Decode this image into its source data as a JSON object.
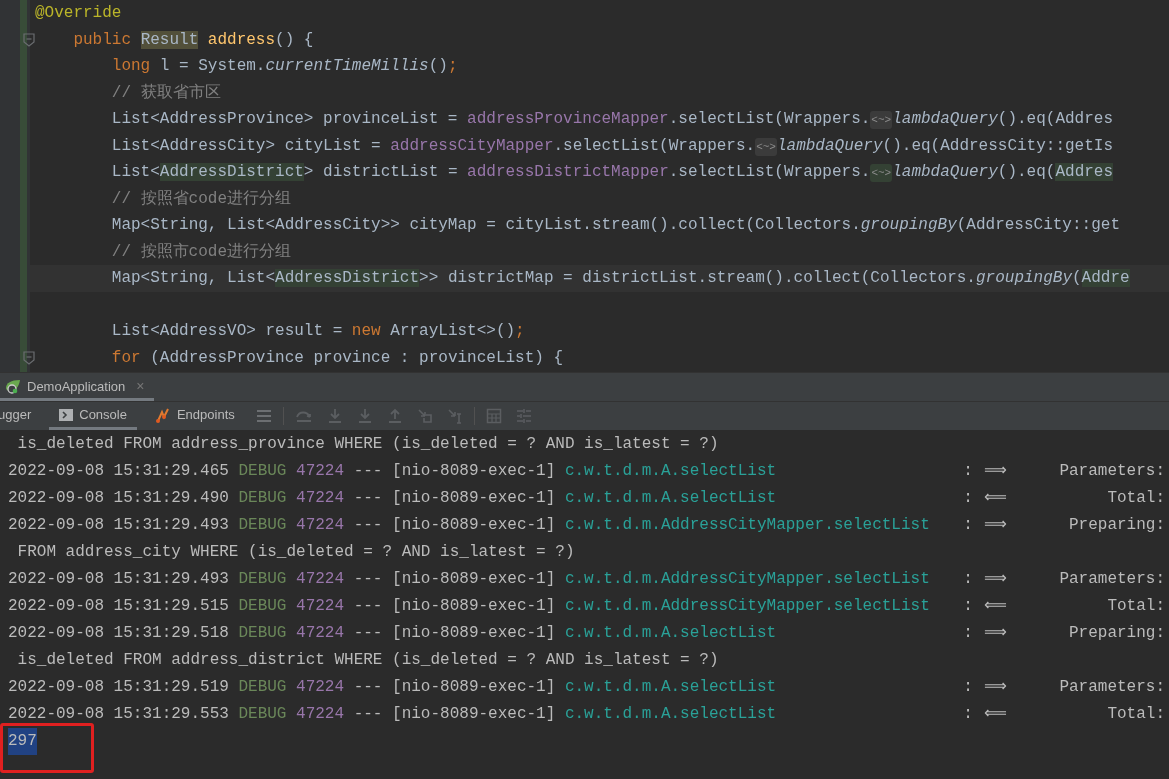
{
  "editor": {
    "lines": [
      {
        "kind": "code",
        "fold": false,
        "current": false,
        "segments": [
          {
            "text": "@Override",
            "kind": "annotation"
          }
        ]
      },
      {
        "kind": "code",
        "fold": true,
        "current": false,
        "segments": [
          {
            "text": "    public ",
            "kind": "keyword"
          },
          {
            "text": "Result",
            "kind": "usage"
          },
          {
            "text": " address",
            "kind": "method"
          },
          {
            "text": "() {",
            "kind": "plain"
          }
        ]
      },
      {
        "kind": "code",
        "fold": false,
        "current": false,
        "segments": [
          {
            "text": "        long",
            "kind": "keyword"
          },
          {
            "text": " l = System.",
            "kind": "plain"
          },
          {
            "text": "currentTimeMillis",
            "kind": "static"
          },
          {
            "text": "()",
            "kind": "plain"
          },
          {
            "text": ";",
            "kind": "keyword"
          }
        ]
      },
      {
        "kind": "code",
        "fold": false,
        "current": false,
        "segments": [
          {
            "text": "        // 获取省市区",
            "kind": "comment"
          }
        ]
      },
      {
        "kind": "code",
        "fold": false,
        "current": false,
        "segments": [
          {
            "text": "        List<AddressProvince> provinceList = ",
            "kind": "plain"
          },
          {
            "text": "addressProvinceMapper",
            "kind": "field"
          },
          {
            "text": ".selectList(Wrappers.",
            "kind": "plain"
          },
          {
            "text": "<~>",
            "kind": "hint"
          },
          {
            "text": "lambdaQuery",
            "kind": "static"
          },
          {
            "text": "().eq(Addres",
            "kind": "plain"
          }
        ]
      },
      {
        "kind": "code",
        "fold": false,
        "current": false,
        "segments": [
          {
            "text": "        List<AddressCity> cityList = ",
            "kind": "plain"
          },
          {
            "text": "addressCityMapper",
            "kind": "field"
          },
          {
            "text": ".selectList(Wrappers.",
            "kind": "plain"
          },
          {
            "text": "<~>",
            "kind": "hint"
          },
          {
            "text": "lambdaQuery",
            "kind": "static"
          },
          {
            "text": "().eq(AddressCity::getIs",
            "kind": "plain"
          }
        ]
      },
      {
        "kind": "code",
        "fold": false,
        "current": false,
        "segments": [
          {
            "text": "        List<",
            "kind": "plain"
          },
          {
            "text": "AddressDistrict",
            "kind": "write"
          },
          {
            "text": "> districtList = ",
            "kind": "plain"
          },
          {
            "text": "addressDistrictMapper",
            "kind": "field"
          },
          {
            "text": ".selectList(Wrappers.",
            "kind": "plain"
          },
          {
            "text": "<~>",
            "kind": "hint-write"
          },
          {
            "text": "lambdaQuery",
            "kind": "static"
          },
          {
            "text": "().eq(",
            "kind": "plain"
          },
          {
            "text": "Addres",
            "kind": "write"
          }
        ]
      },
      {
        "kind": "code",
        "fold": false,
        "current": false,
        "segments": [
          {
            "text": "        // 按照省code进行分组",
            "kind": "comment"
          }
        ]
      },
      {
        "kind": "code",
        "fold": false,
        "current": false,
        "segments": [
          {
            "text": "        Map<String, List<AddressCity>> cityMap = cityList.stream().collect(Collectors.",
            "kind": "plain"
          },
          {
            "text": "groupingBy",
            "kind": "static"
          },
          {
            "text": "(AddressCity::get",
            "kind": "plain"
          }
        ]
      },
      {
        "kind": "code",
        "fold": false,
        "current": false,
        "segments": [
          {
            "text": "        // 按照市code进行分组",
            "kind": "comment"
          }
        ]
      },
      {
        "kind": "code",
        "fold": false,
        "current": true,
        "segments": [
          {
            "text": "        Map<String, List<",
            "kind": "plain"
          },
          {
            "text": "AddressDistrict",
            "kind": "write"
          },
          {
            "text": ">> districtMap = districtList.stream().collect(Collectors.",
            "kind": "plain"
          },
          {
            "text": "groupingBy",
            "kind": "static"
          },
          {
            "text": "(",
            "kind": "plain"
          },
          {
            "text": "Addre",
            "kind": "write"
          }
        ]
      },
      {
        "kind": "blank",
        "fold": false,
        "current": false
      },
      {
        "kind": "code",
        "fold": false,
        "current": false,
        "segments": [
          {
            "text": "        List<AddressVO> result = ",
            "kind": "plain"
          },
          {
            "text": "new",
            "kind": "keyword"
          },
          {
            "text": " ArrayList<>()",
            "kind": "plain"
          },
          {
            "text": ";",
            "kind": "keyword"
          }
        ]
      },
      {
        "kind": "code",
        "fold": true,
        "current": false,
        "segments": [
          {
            "text": "        for",
            "kind": "keyword"
          },
          {
            "text": " (AddressProvince province : provinceList) {",
            "kind": "plain"
          }
        ]
      }
    ]
  },
  "run_tab": {
    "label": "DemoApplication",
    "close": "×"
  },
  "tool_tabs": [
    {
      "label": "ugger",
      "selected": false,
      "kind": "plain"
    },
    {
      "label": "Console",
      "selected": true,
      "kind": "console"
    },
    {
      "label": "Endpoints",
      "selected": false,
      "kind": "endpoints"
    }
  ],
  "console": [
    {
      "kind": "sql",
      "text": " is_deleted FROM address_province WHERE (is_deleted = ? AND is_latest = ?)"
    },
    {
      "kind": "log",
      "time": "2022-09-08 15:31:29.465",
      "level": "DEBUG",
      "pid": "47224",
      "sep": "---",
      "thread": "[nio-8089-exec-1]",
      "logger": "c.w.t.d.m.A.selectList",
      "colon": ":",
      "arrow": "⟹",
      "message": "Parameters:"
    },
    {
      "kind": "log",
      "time": "2022-09-08 15:31:29.490",
      "level": "DEBUG",
      "pid": "47224",
      "sep": "---",
      "thread": "[nio-8089-exec-1]",
      "logger": "c.w.t.d.m.A.selectList",
      "colon": ":",
      "arrow": "⟸",
      "message": "Total:"
    },
    {
      "kind": "log",
      "time": "2022-09-08 15:31:29.493",
      "level": "DEBUG",
      "pid": "47224",
      "sep": "---",
      "thread": "[nio-8089-exec-1]",
      "logger": "c.w.t.d.m.AddressCityMapper.selectList",
      "colon": ":",
      "arrow": "⟹",
      "message": "Preparing:"
    },
    {
      "kind": "sql",
      "text": " FROM address_city WHERE (is_deleted = ? AND is_latest = ?)"
    },
    {
      "kind": "log",
      "time": "2022-09-08 15:31:29.493",
      "level": "DEBUG",
      "pid": "47224",
      "sep": "---",
      "thread": "[nio-8089-exec-1]",
      "logger": "c.w.t.d.m.AddressCityMapper.selectList",
      "colon": ":",
      "arrow": "⟹",
      "message": "Parameters:"
    },
    {
      "kind": "log",
      "time": "2022-09-08 15:31:29.515",
      "level": "DEBUG",
      "pid": "47224",
      "sep": "---",
      "thread": "[nio-8089-exec-1]",
      "logger": "c.w.t.d.m.AddressCityMapper.selectList",
      "colon": ":",
      "arrow": "⟸",
      "message": "Total:"
    },
    {
      "kind": "log",
      "time": "2022-09-08 15:31:29.518",
      "level": "DEBUG",
      "pid": "47224",
      "sep": "---",
      "thread": "[nio-8089-exec-1]",
      "logger": "c.w.t.d.m.A.selectList",
      "colon": ":",
      "arrow": "⟹",
      "message": "Preparing:"
    },
    {
      "kind": "sql",
      "text": " is_deleted FROM address_district WHERE (is_deleted = ? AND is_latest = ?)"
    },
    {
      "kind": "log",
      "time": "2022-09-08 15:31:29.519",
      "level": "DEBUG",
      "pid": "47224",
      "sep": "---",
      "thread": "[nio-8089-exec-1]",
      "logger": "c.w.t.d.m.A.selectList",
      "colon": ":",
      "arrow": "⟹",
      "message": "Parameters:"
    },
    {
      "kind": "log",
      "time": "2022-09-08 15:31:29.553",
      "level": "DEBUG",
      "pid": "47224",
      "sep": "---",
      "thread": "[nio-8089-exec-1]",
      "logger": "c.w.t.d.m.A.selectList",
      "colon": ":",
      "arrow": "⟸",
      "message": "Total:"
    },
    {
      "kind": "output",
      "text": "297",
      "selected": true,
      "marked": true
    }
  ]
}
